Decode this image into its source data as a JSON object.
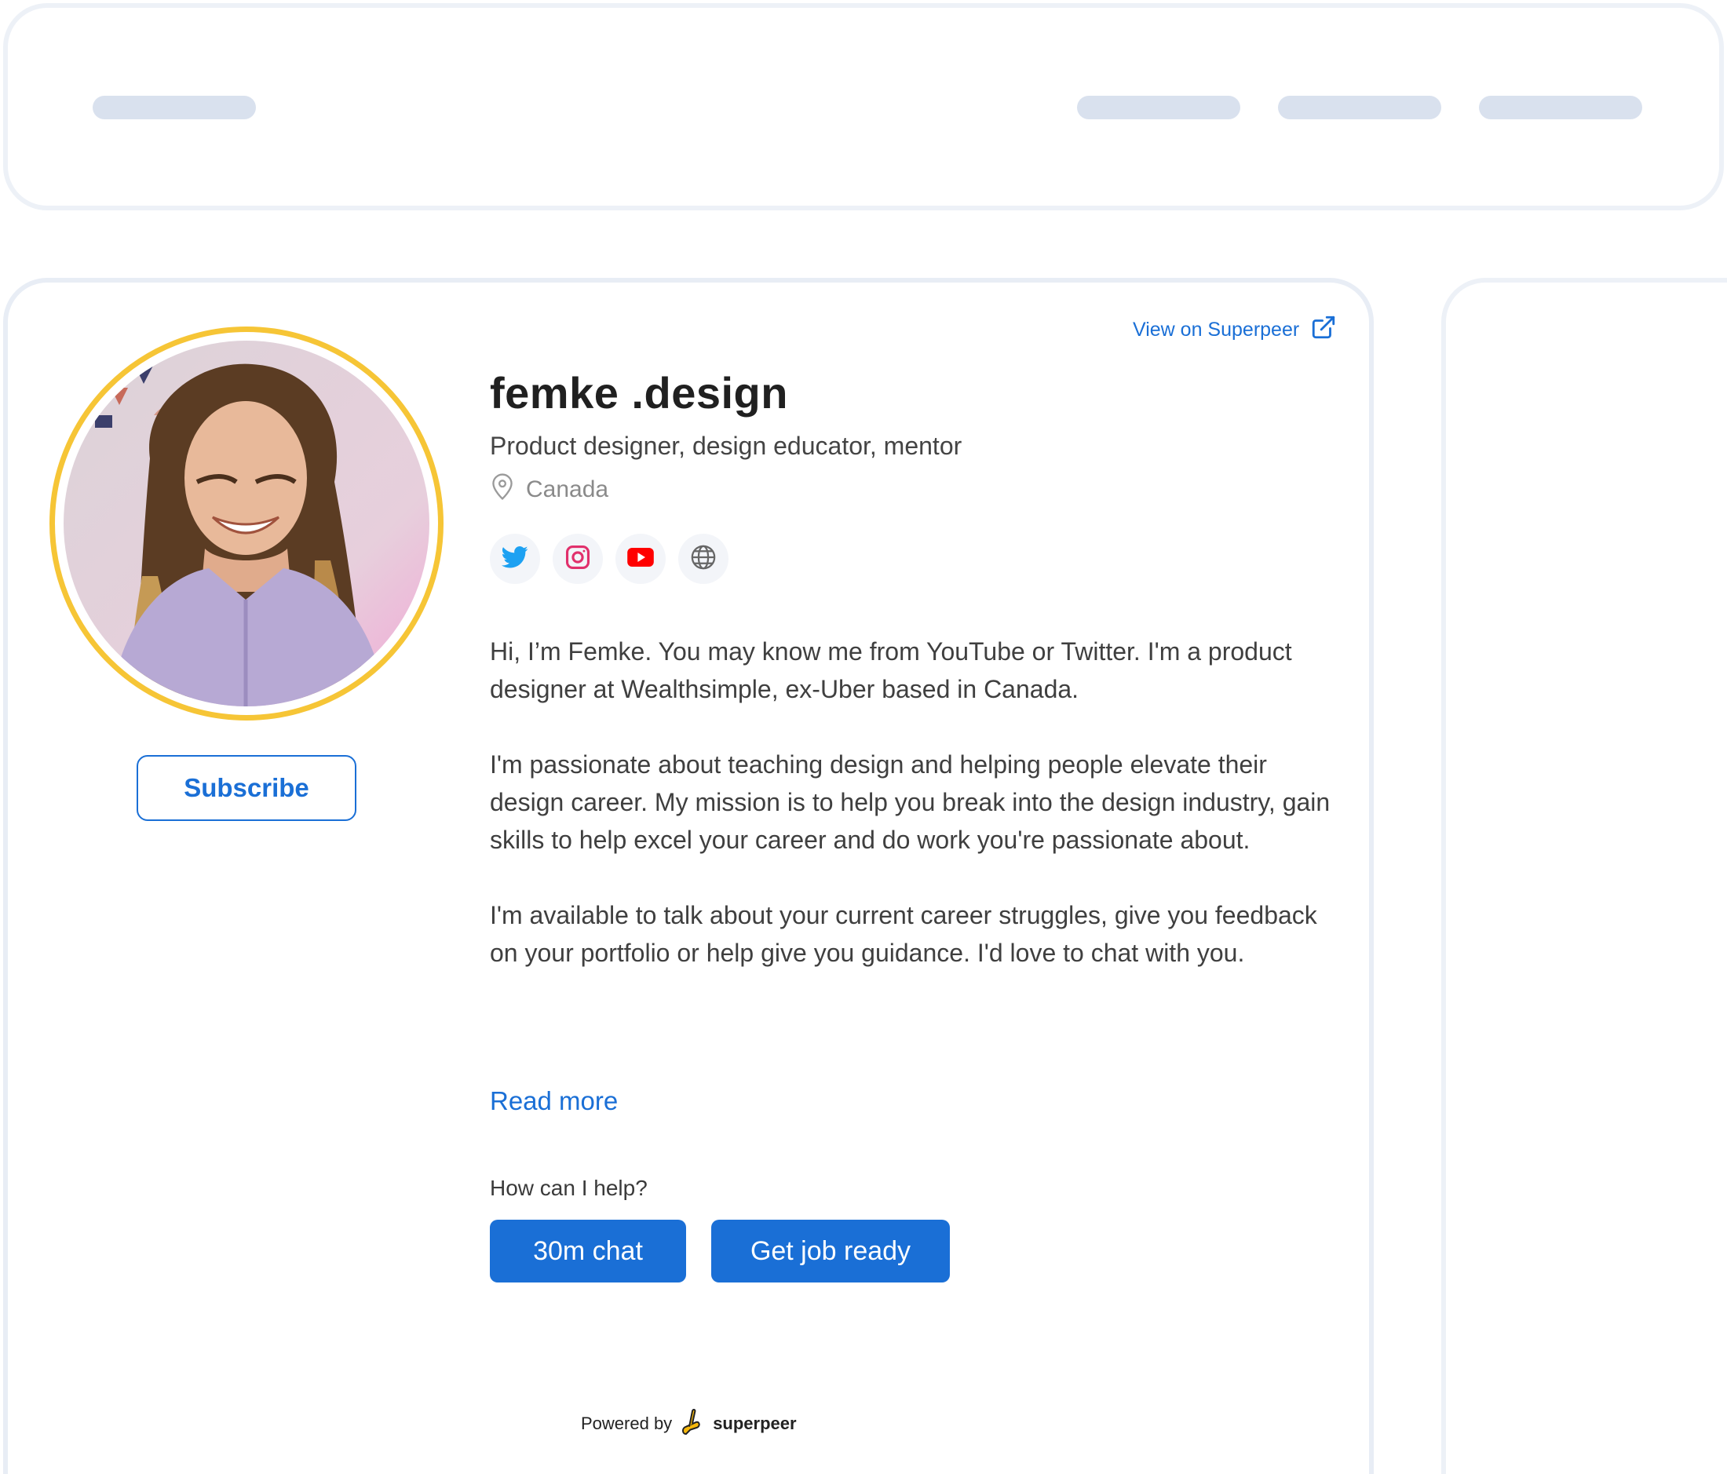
{
  "header": {
    "placeholders": [
      "logo-placeholder",
      "nav-placeholder-1",
      "nav-placeholder-2",
      "nav-placeholder-3"
    ]
  },
  "profile": {
    "view_link_label": "View on Superpeer",
    "name": "femke .design",
    "tagline": "Product designer, design educator, mentor",
    "location": "Canada",
    "subscribe_label": "Subscribe",
    "socials": [
      {
        "name": "twitter-icon",
        "color": "#1da1f2"
      },
      {
        "name": "instagram-icon",
        "color": "#e1306c"
      },
      {
        "name": "youtube-icon",
        "color": "#ff0000"
      },
      {
        "name": "globe-icon",
        "color": "#666666"
      }
    ],
    "bio": [
      "Hi, I’m Femke. You may know me from YouTube or Twitter. I'm a product designer at Wealthsimple, ex-Uber based in Canada.",
      "I'm passionate about teaching design and helping people elevate their design career. My mission is to help you break into the design industry, gain skills to help excel your career and do work you're passionate about.",
      "I'm available to talk about your current career struggles, give you feedback on your portfolio or help give you guidance. I'd love to chat with you."
    ],
    "read_more_label": "Read more",
    "help_label": "How can I help?",
    "actions": [
      "30m chat",
      "Get job ready"
    ]
  },
  "footer": {
    "powered_by": "Powered by",
    "brand": "superpeer"
  },
  "colors": {
    "accent": "#1a6fd6",
    "avatar_ring": "#f6c536",
    "skeleton": "#d9e1ee"
  }
}
